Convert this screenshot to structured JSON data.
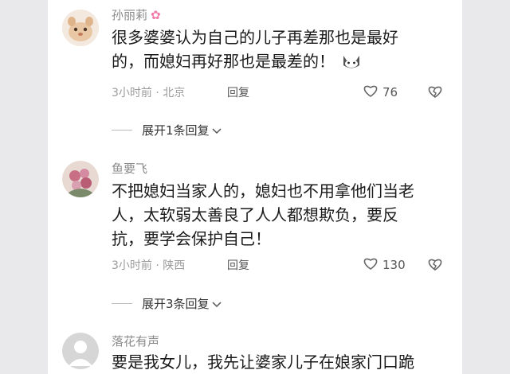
{
  "comments": [
    {
      "username": "孙丽莉",
      "body_line1": "很多婆婆认为自己的儿子再差那也是最好",
      "body_line2": "的，而媳妇再好那也是最差的！",
      "time_location": "3小时前 · 北京",
      "reply_label": "回复",
      "likes": "76",
      "expand_label": "展开1条回复"
    },
    {
      "username": "鱼要飞",
      "body_line1": "不把媳妇当家人的，媳妇也不用拿他们当老",
      "body_line2": "人，太软弱太善良了人人都想欺负，要反",
      "body_line3": "抗，要学会保护自己！",
      "time_location": "3小时前 · 陕西",
      "reply_label": "回复",
      "likes": "130",
      "expand_label": "展开3条回复"
    },
    {
      "username": "落花有声",
      "body_line1": "要是我女儿，我先让婆家儿子在娘家门口跪"
    }
  ],
  "colors": {
    "page_bg": "#e9e9eb",
    "panel_bg": "#ffffff",
    "username": "#8a8a8a",
    "text": "#1a1a1a",
    "meta": "#9b9b9b"
  },
  "icons": [
    "flower-emoji-icon",
    "cat-emoji-icon",
    "heart-icon",
    "dislike-heart-icon",
    "chevron-down-icon"
  ]
}
